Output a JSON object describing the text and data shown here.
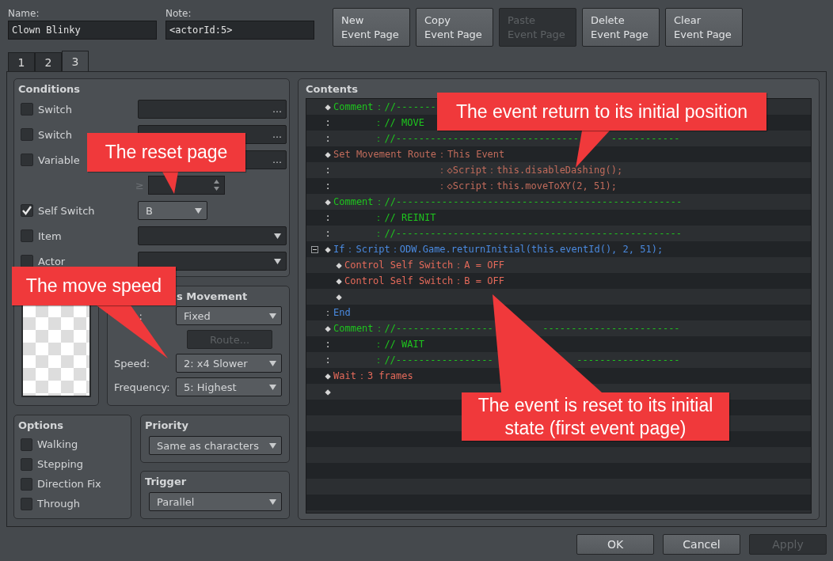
{
  "header": {
    "name": {
      "label": "Name:",
      "value": "Clown Blinky"
    },
    "note": {
      "label": "Note:",
      "value": "<actorId:5>"
    },
    "buttons": [
      {
        "lines": [
          "New",
          "Event Page"
        ],
        "disabled": false
      },
      {
        "lines": [
          "Copy",
          "Event Page"
        ],
        "disabled": false
      },
      {
        "lines": [
          "Paste",
          "Event Page"
        ],
        "disabled": true
      },
      {
        "lines": [
          "Delete",
          "Event Page"
        ],
        "disabled": false
      },
      {
        "lines": [
          "Clear",
          "Event Page"
        ],
        "disabled": false
      }
    ]
  },
  "tabs": [
    {
      "label": "1",
      "selected": false
    },
    {
      "label": "2",
      "selected": false
    },
    {
      "label": "3",
      "selected": true
    }
  ],
  "conditions": {
    "title": "Conditions",
    "rows": [
      {
        "kind": "picker",
        "label": "Switch",
        "checked": false,
        "button": "…"
      },
      {
        "kind": "picker",
        "label": "Switch",
        "checked": false,
        "button": "…"
      },
      {
        "kind": "picker",
        "label": "Variable",
        "checked": false,
        "button": "…"
      },
      {
        "kind": "compare",
        "symbol": "≥"
      },
      {
        "kind": "dropdown",
        "label": "Self Switch",
        "checked": true,
        "value": "B"
      },
      {
        "kind": "dropdown",
        "label": "Item",
        "checked": false
      },
      {
        "kind": "dropdown",
        "label": "Actor",
        "checked": false
      }
    ]
  },
  "autonomous_movement": {
    "title": "s Movement",
    "type_label": ":",
    "type": "Fixed",
    "route_button": {
      "label": "Route...",
      "disabled": true
    },
    "speed_label": "Speed:",
    "speed": "2: x4 Slower",
    "frequency_label": "Frequency:",
    "frequency": "5: Highest"
  },
  "options": {
    "title": "Options",
    "items": [
      {
        "label": "Walking",
        "checked": false
      },
      {
        "label": "Stepping",
        "checked": false
      },
      {
        "label": "Direction Fix",
        "checked": false
      },
      {
        "label": "Through",
        "checked": false
      }
    ]
  },
  "priority": {
    "title": "Priority",
    "value": "Same as characters"
  },
  "trigger": {
    "title": "Trigger",
    "value": "Parallel"
  },
  "contents": {
    "title": "Contents",
    "lines": [
      {
        "marker": "◆",
        "kind": "comment",
        "head": "Comment",
        "sep": "：",
        "body": "//-------"
      },
      {
        "marker": ":",
        "kind": "comment",
        "sep": "：",
        "body": "// MOVE"
      },
      {
        "marker": ":",
        "kind": "comment",
        "sep": "：",
        "body": [
          "//--------------------------------",
          "------------"
        ]
      },
      {
        "marker": "◆",
        "kind": "route",
        "head": "Set Movement Route",
        "sep": "：",
        "body": "This Event"
      },
      {
        "marker": ":",
        "kind": "route",
        "sep": "：",
        "body": "◇Script：this.disableDashing();"
      },
      {
        "marker": ":",
        "kind": "route",
        "sep": "：",
        "body": "◇Script：this.moveToXY(2, 51);"
      },
      {
        "marker": "◆",
        "kind": "comment",
        "head": "Comment",
        "sep": "：",
        "body": "//--------------------------------------------------"
      },
      {
        "marker": ":",
        "kind": "comment",
        "sep": "：",
        "body": "// REINIT"
      },
      {
        "marker": ":",
        "kind": "comment",
        "sep": "：",
        "body": "//--------------------------------------------------"
      },
      {
        "marker": "◆",
        "kind": "flow",
        "head": "If",
        "sep": "：",
        "body": "Script：ODW.Game.returnInitial(this.eventId(), 2, 51);",
        "expanded": true,
        "children": [
          {
            "marker": "◆",
            "kind": "command",
            "head": "Control Self Switch",
            "sep": "：",
            "body": "A = OFF"
          },
          {
            "marker": "◆",
            "kind": "command",
            "head": "Control Self Switch",
            "sep": "：",
            "body": "B = OFF"
          },
          {
            "marker": "◆",
            "kind": "command"
          }
        ]
      },
      {
        "marker": "：",
        "kind": "flow",
        "head": "End"
      },
      {
        "marker": "◆",
        "kind": "comment",
        "head": "Comment",
        "sep": "：",
        "body": [
          "//-----------------",
          "------------------------"
        ]
      },
      {
        "marker": ":",
        "kind": "comment",
        "sep": "：",
        "body": "// WAIT"
      },
      {
        "marker": ":",
        "kind": "comment",
        "sep": "：",
        "body": [
          "//-----------------",
          "------------------"
        ]
      },
      {
        "marker": "◆",
        "kind": "command",
        "head": "Wait",
        "sep": "：",
        "body": "3 frames"
      },
      {
        "marker": "◆",
        "kind": "command"
      }
    ]
  },
  "footer": {
    "buttons": [
      {
        "label": "OK",
        "disabled": false
      },
      {
        "label": "Cancel",
        "disabled": false
      },
      {
        "label": "Apply",
        "disabled": true
      }
    ]
  },
  "callouts": [
    {
      "text": "The reset page"
    },
    {
      "text": "The move speed"
    },
    {
      "text": "The event return to its initial position"
    },
    {
      "text": "The event is reset to its initial state (first event page)"
    }
  ]
}
